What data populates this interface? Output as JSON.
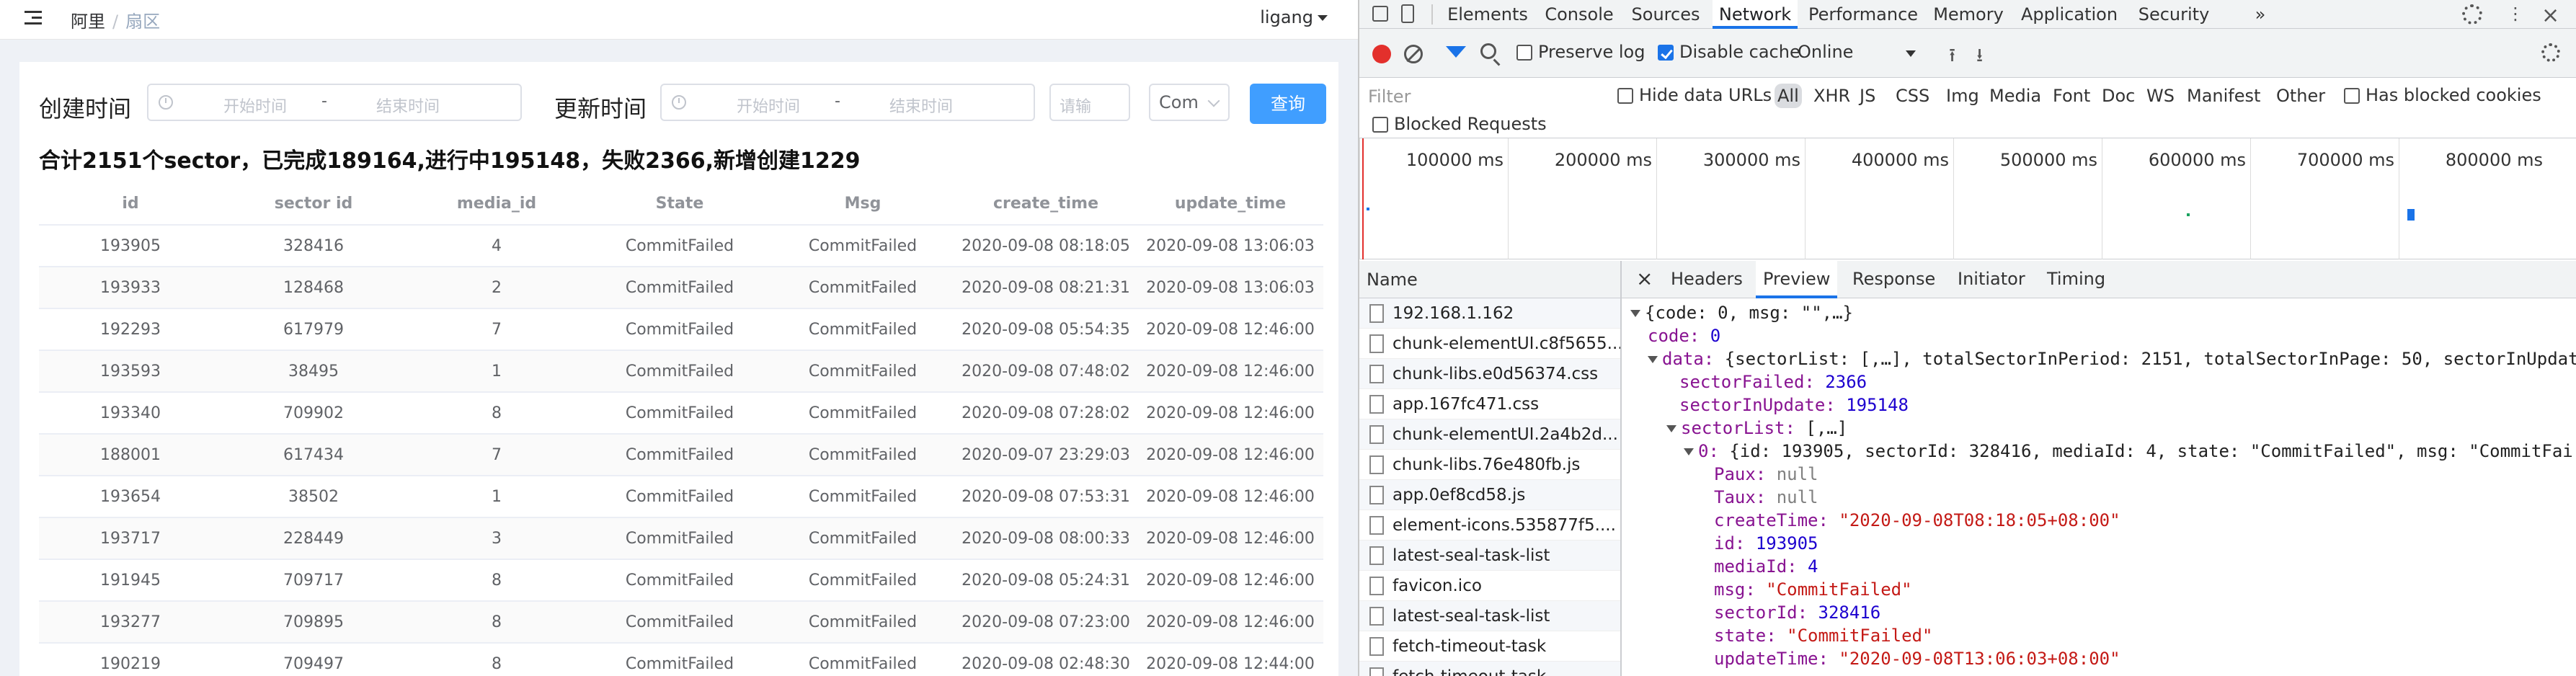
{
  "app": {
    "breadcrumb": [
      "阿里",
      "扇区"
    ],
    "user": "ligang",
    "filter": {
      "created_label": "创建时间",
      "updated_label": "更新时间",
      "start_placeholder": "开始时间",
      "end_placeholder": "结束时间",
      "range_sep": "-",
      "input_placeholder": "请输",
      "select_value": "Com",
      "query_button": "查询"
    },
    "summary": "合计2151个sector，已完成189164,进行中195148，失败2366,新增创建1229",
    "table": {
      "columns": [
        "id",
        "sector id",
        "media_id",
        "State",
        "Msg",
        "create_time",
        "update_time"
      ],
      "rows": [
        [
          "193905",
          "328416",
          "4",
          "CommitFailed",
          "CommitFailed",
          "2020-09-08 08:18:05",
          "2020-09-08 13:06:03"
        ],
        [
          "193933",
          "128468",
          "2",
          "CommitFailed",
          "CommitFailed",
          "2020-09-08 08:21:31",
          "2020-09-08 13:06:03"
        ],
        [
          "192293",
          "617979",
          "7",
          "CommitFailed",
          "CommitFailed",
          "2020-09-08 05:54:35",
          "2020-09-08 12:46:00"
        ],
        [
          "193593",
          "38495",
          "1",
          "CommitFailed",
          "CommitFailed",
          "2020-09-08 07:48:02",
          "2020-09-08 12:46:00"
        ],
        [
          "193340",
          "709902",
          "8",
          "CommitFailed",
          "CommitFailed",
          "2020-09-08 07:28:02",
          "2020-09-08 12:46:00"
        ],
        [
          "188001",
          "617434",
          "7",
          "CommitFailed",
          "CommitFailed",
          "2020-09-07 23:29:03",
          "2020-09-08 12:46:00"
        ],
        [
          "193654",
          "38502",
          "1",
          "CommitFailed",
          "CommitFailed",
          "2020-09-08 07:53:31",
          "2020-09-08 12:46:00"
        ],
        [
          "193717",
          "228449",
          "3",
          "CommitFailed",
          "CommitFailed",
          "2020-09-08 08:00:33",
          "2020-09-08 12:46:00"
        ],
        [
          "191945",
          "709717",
          "8",
          "CommitFailed",
          "CommitFailed",
          "2020-09-08 05:24:31",
          "2020-09-08 12:46:00"
        ],
        [
          "193277",
          "709895",
          "8",
          "CommitFailed",
          "CommitFailed",
          "2020-09-08 07:23:00",
          "2020-09-08 12:46:00"
        ],
        [
          "190219",
          "709497",
          "8",
          "CommitFailed",
          "CommitFailed",
          "2020-09-08 02:48:30",
          "2020-09-08 12:44:00"
        ]
      ]
    }
  },
  "devtools": {
    "tabs": [
      "Elements",
      "Console",
      "Sources",
      "Network",
      "Performance",
      "Memory",
      "Application",
      "Security",
      "»"
    ],
    "active_tab": "Network",
    "toolbar": {
      "preserve_log": "Preserve log",
      "disable_cache": "Disable cache",
      "throttle": "Online"
    },
    "filter": {
      "placeholder": "Filter",
      "hide_data_urls": "Hide data URLs",
      "types": [
        "All",
        "XHR",
        "JS",
        "CSS",
        "Img",
        "Media",
        "Font",
        "Doc",
        "WS",
        "Manifest",
        "Other"
      ],
      "has_blocked": "Has blocked cookies",
      "blocked_requests": "Blocked Requests"
    },
    "timeline_ticks": [
      "100000 ms",
      "200000 ms",
      "300000 ms",
      "400000 ms",
      "500000 ms",
      "600000 ms",
      "700000 ms",
      "800000 ms"
    ],
    "names_header": "Name",
    "requests": [
      "192.168.1.162",
      "chunk-elementUI.c8f5655...",
      "chunk-libs.e0d56374.css",
      "app.167fc471.css",
      "chunk-elementUI.2a4b2d...",
      "chunk-libs.76e480fb.js",
      "app.0ef8cd58.js",
      "element-icons.535877f5....",
      "latest-seal-task-list",
      "favicon.ico",
      "latest-seal-task-list",
      "fetch-timeout-task",
      "fetch-timeout-task"
    ],
    "detail_tabs": [
      "Headers",
      "Preview",
      "Response",
      "Initiator",
      "Timing"
    ],
    "active_detail_tab": "Preview",
    "close_glyph": "×",
    "json": {
      "l0": "{code: 0, msg: \"\",…}",
      "code_k": "code:",
      "code_v": "0",
      "data_k": "data:",
      "data_v": "{sectorList: [,…], totalSectorInPeriod: 2151, totalSectorInPage: 50, sectorInUpdat",
      "sf_k": "sectorFailed:",
      "sf_v": "2366",
      "siu_k": "sectorInUpdate:",
      "siu_v": "195148",
      "sl_k": "sectorList:",
      "sl_v": "[,…]",
      "i0_k": "0:",
      "i0_v": "{id: 193905, sectorId: 328416, mediaId: 4, state: \"CommitFailed\", msg: \"CommitFai",
      "paux_k": "Paux:",
      "paux_v": "null",
      "taux_k": "Taux:",
      "taux_v": "null",
      "ct_k": "createTime:",
      "ct_v": "\"2020-09-08T08:18:05+08:00\"",
      "id_k": "id:",
      "id_v": "193905",
      "mid_k": "mediaId:",
      "mid_v": "4",
      "msg_k": "msg:",
      "msg_v": "\"CommitFailed\"",
      "sid_k": "sectorId:",
      "sid_v": "328416",
      "st_k": "state:",
      "st_v": "\"CommitFailed\"",
      "ut_k": "updateTime:",
      "ut_v": "\"2020-09-08T13:06:03+08:00\""
    }
  }
}
